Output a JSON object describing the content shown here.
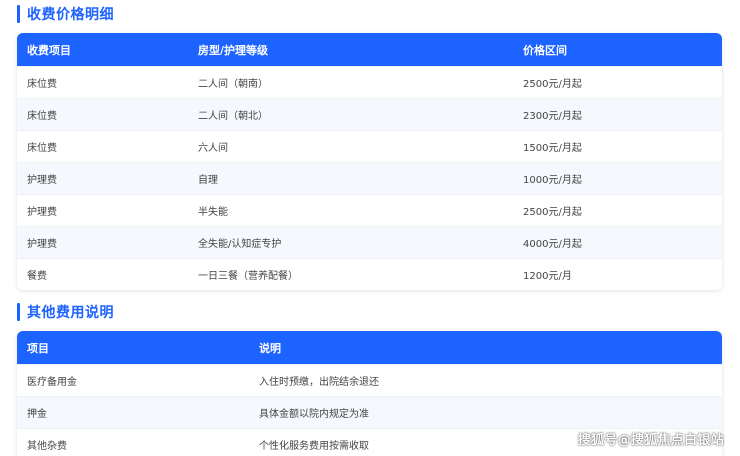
{
  "colors": {
    "accent": "#1d63ff",
    "header_text": "#ffffff",
    "zebra_row": "#f5f8fc"
  },
  "fees": {
    "title": "收费价格明细",
    "headers": [
      "收费项目",
      "房型/护理等级",
      "价格区间"
    ],
    "rows": [
      [
        "床位费",
        "二人间（朝南）",
        "2500元/月起"
      ],
      [
        "床位费",
        "二人间（朝北）",
        "2300元/月起"
      ],
      [
        "床位费",
        "六人间",
        "1500元/月起"
      ],
      [
        "护理费",
        "自理",
        "1000元/月起"
      ],
      [
        "护理费",
        "半失能",
        "2500元/月起"
      ],
      [
        "护理费",
        "全失能/认知症专护",
        "4000元/月起"
      ],
      [
        "餐费",
        "一日三餐（营养配餐）",
        "1200元/月"
      ]
    ]
  },
  "other": {
    "title": "其他费用说明",
    "headers": [
      "项目",
      "说明"
    ],
    "rows": [
      [
        "医疗备用金",
        "入住时预缴，出院结余退还"
      ],
      [
        "押金",
        "具体金额以院内规定为准"
      ],
      [
        "其他杂费",
        "个性化服务费用按需收取"
      ]
    ]
  },
  "watermark": "搜狐号@搜狐焦点白银站"
}
